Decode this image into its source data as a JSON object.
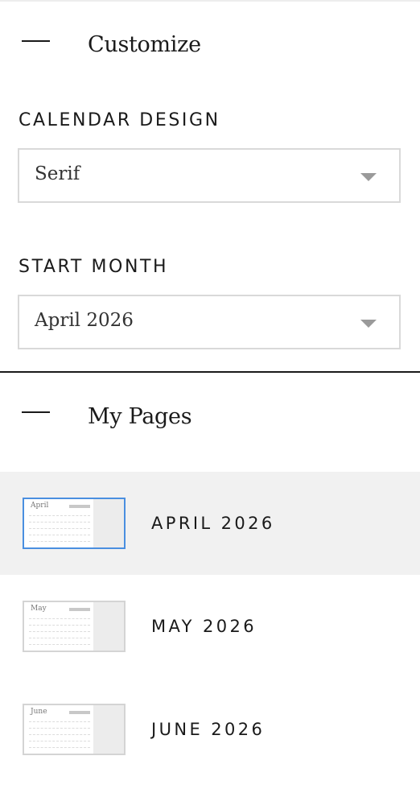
{
  "customize": {
    "title": "Customize",
    "calendar_design": {
      "label": "CALENDAR DESIGN",
      "value": "Serif"
    },
    "start_month": {
      "label": "START MONTH",
      "value": "April 2026"
    }
  },
  "my_pages": {
    "title": "My Pages",
    "pages": [
      {
        "label": "APRIL 2026",
        "thumb_month": "April",
        "selected": true
      },
      {
        "label": "MAY 2026",
        "thumb_month": "May",
        "selected": false
      },
      {
        "label": "JUNE 2026",
        "thumb_month": "June",
        "selected": false
      }
    ]
  },
  "colors": {
    "selected_row_bg": "#f1f1f1",
    "selected_thumb_border": "#4a8fe0"
  }
}
